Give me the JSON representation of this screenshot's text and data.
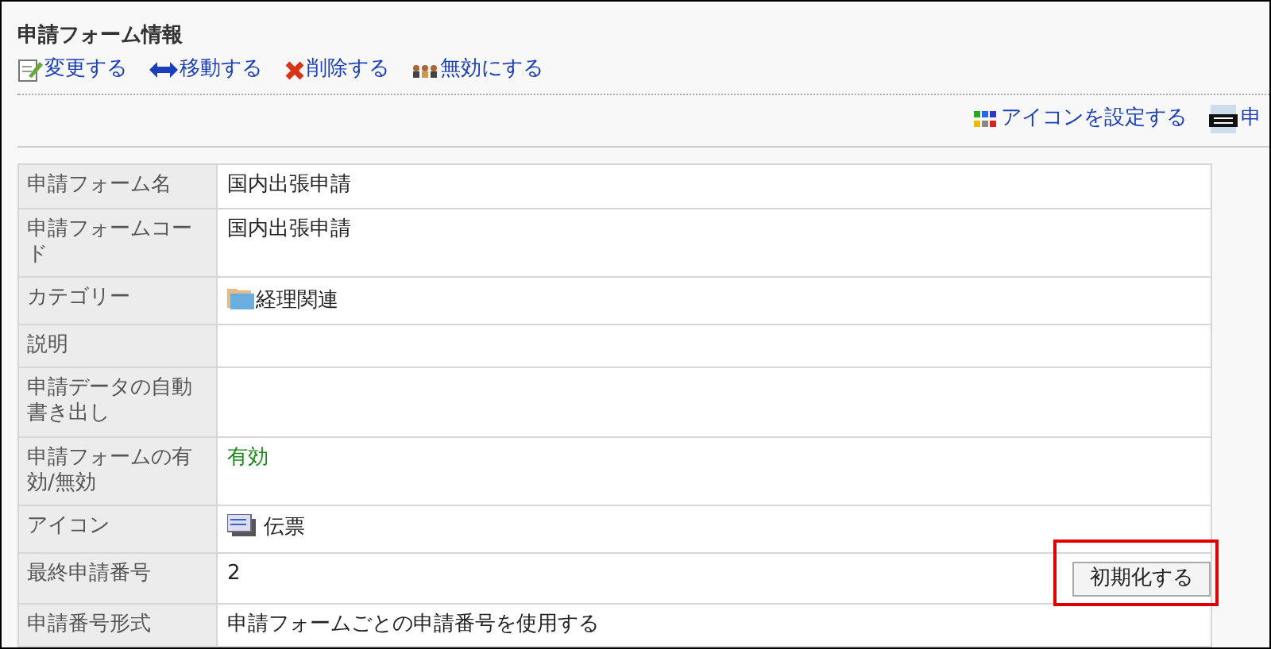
{
  "heading": "申請フォーム情報",
  "actions": [
    {
      "kind": "edit",
      "label": "変更する"
    },
    {
      "kind": "move",
      "label": "移動する"
    },
    {
      "kind": "delete",
      "label": "削除する"
    },
    {
      "kind": "disable",
      "label": "無効にする"
    }
  ],
  "tools": [
    {
      "kind": "icon-set",
      "label": "アイコンを設定する"
    },
    {
      "kind": "number",
      "label": "申"
    }
  ],
  "rows": [
    {
      "label": "申請フォーム名",
      "value": "国内出張申請"
    },
    {
      "label": "申請フォームコード",
      "value": "国内出張申請"
    },
    {
      "label": "カテゴリー",
      "value": "経理関連",
      "kind": "category"
    },
    {
      "label": "説明"
    },
    {
      "label": "申請データの自動書き出し"
    },
    {
      "label": "申請フォームの有効/無効",
      "value": "有効",
      "kind": "status"
    },
    {
      "label": "アイコン",
      "value": "伝票",
      "kind": "icon"
    },
    {
      "label": "最終申請番号",
      "value": "2",
      "kind": "reset",
      "button": "初期化する",
      "highlighted": true
    },
    {
      "label": "申請番号形式",
      "value": "申請フォームごとの申請番号を使用する"
    }
  ]
}
